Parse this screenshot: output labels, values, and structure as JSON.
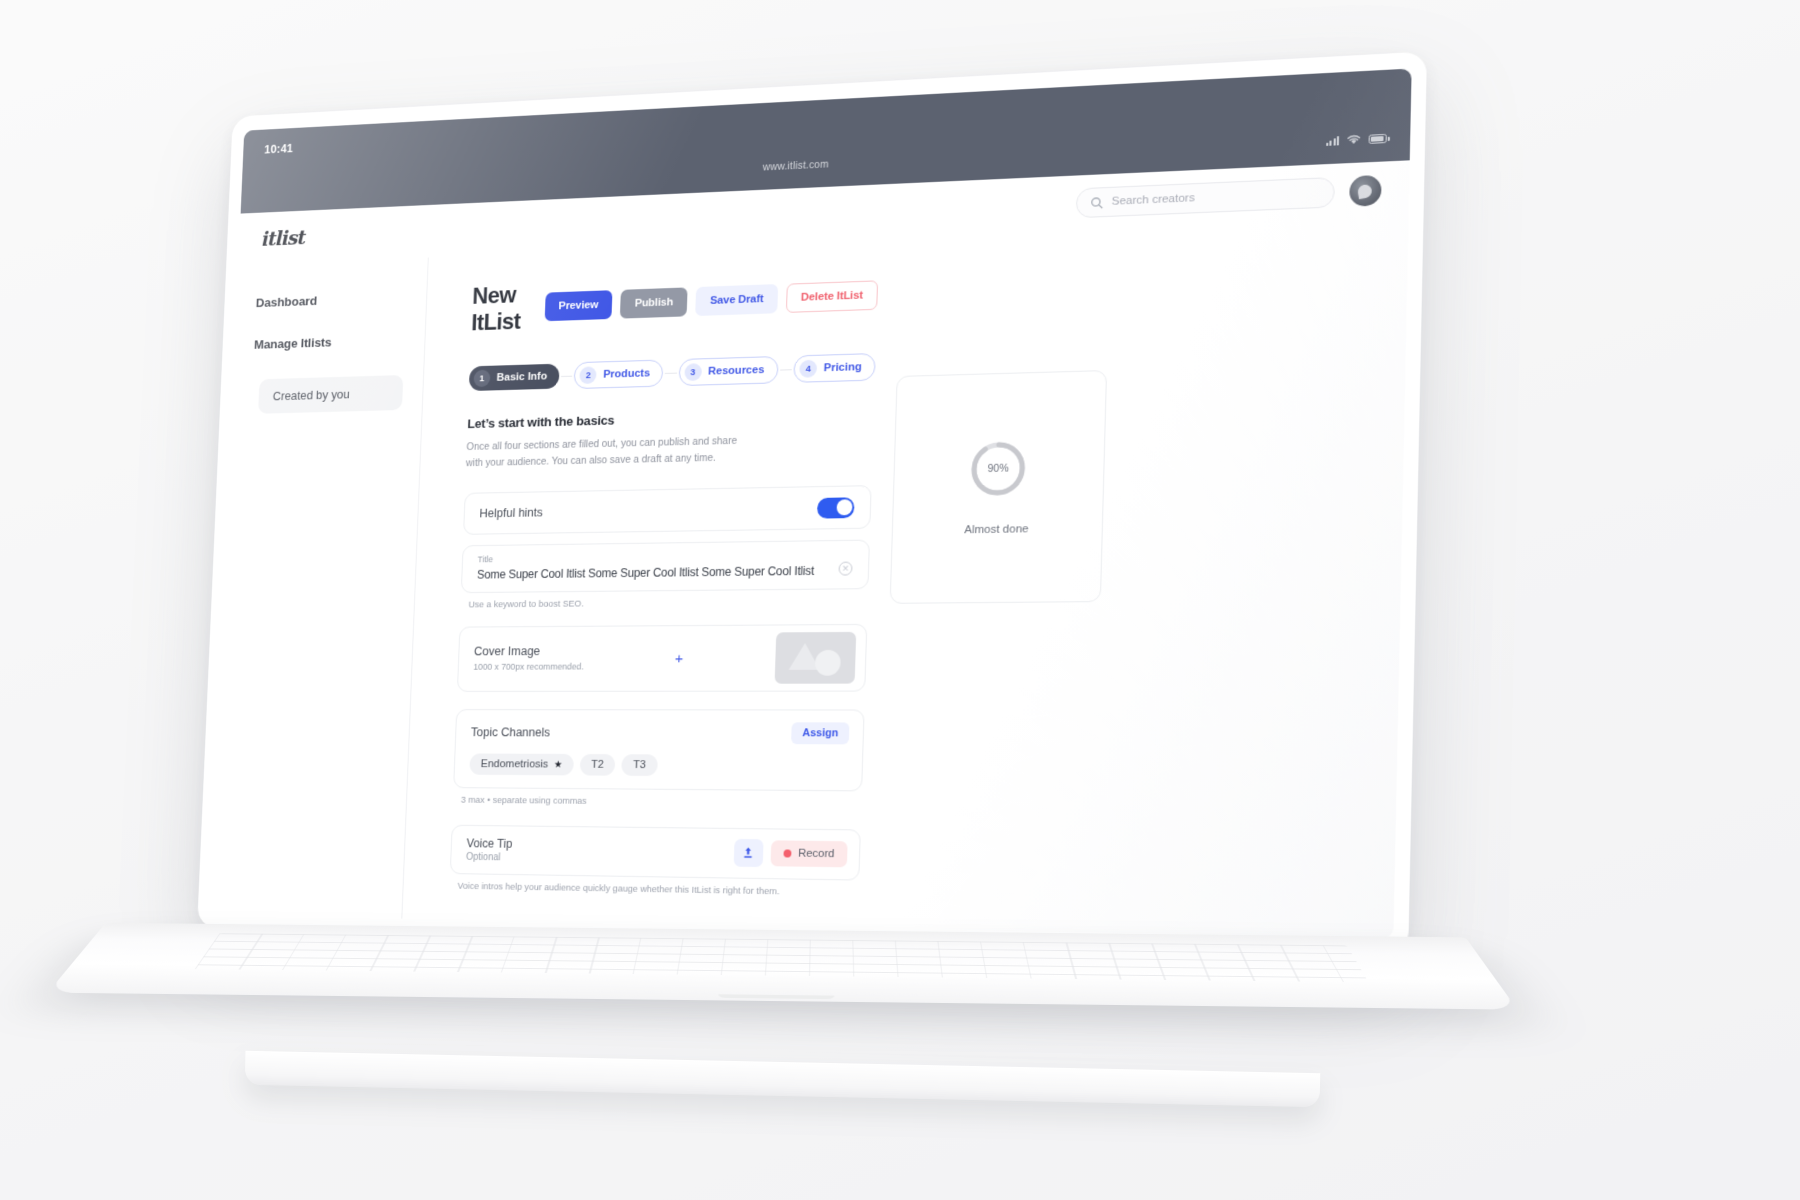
{
  "device": {
    "status_bar": {
      "clock": "10:41",
      "signal_icon": "signal-bars-icon",
      "wifi_icon": "wifi-icon",
      "battery_icon": "battery-icon"
    },
    "browser": {
      "url": "www.itlist.com"
    }
  },
  "appbar": {
    "logo": "itlist",
    "search": {
      "placeholder": "Search creators",
      "icon": "search-icon",
      "value": ""
    },
    "avatar": "user-avatar"
  },
  "sidebar": {
    "items": [
      {
        "label": "Dashboard"
      },
      {
        "label": "Manage Itlists"
      }
    ],
    "sub_items": [
      {
        "label": "Created by you",
        "selected": true
      }
    ]
  },
  "header": {
    "title": "New ItList",
    "buttons": [
      {
        "label": "Preview",
        "style": "primary",
        "color": "#4158e6"
      },
      {
        "label": "Publish",
        "style": "muted",
        "color": "#9499a6"
      },
      {
        "label": "Save Draft",
        "style": "soft",
        "color": "#4158e6"
      },
      {
        "label": "Delete ItList",
        "style": "danger-outline",
        "color": "#f0616e"
      }
    ]
  },
  "stepper": {
    "steps": [
      {
        "num": "1",
        "label": "Basic Info",
        "state": "active"
      },
      {
        "num": "2",
        "label": "Products",
        "state": "idle"
      },
      {
        "num": "3",
        "label": "Resources",
        "state": "idle"
      },
      {
        "num": "4",
        "label": "Pricing",
        "state": "idle"
      }
    ]
  },
  "section": {
    "title": "Let’s start with the basics",
    "description": "Once all four sections are filled out, you can publish and share with your audience.  You can also  save a draft at any time."
  },
  "hints": {
    "label": "Helpful hints",
    "toggle_on": true
  },
  "title_field": {
    "label": "Title",
    "value": "Some Super Cool Itlist Some Super Cool Itlist Some Super Cool Itlist",
    "clear_icon": "clear-circle-icon",
    "helper": "Use a keyword to boost SEO."
  },
  "cover_image": {
    "title": "Cover Image",
    "subtitle": "1000 x 700px recommended.",
    "add_icon": "plus-icon",
    "thumbnail": "image-placeholder"
  },
  "topics": {
    "title": "Topic Channels",
    "assign_label": "Assign",
    "tags": [
      {
        "label": "Endometriosis",
        "starred": true,
        "star_icon": "star-icon"
      },
      {
        "label": "T2",
        "starred": false
      },
      {
        "label": "T3",
        "starred": false
      }
    ],
    "helper": "3 max • separate using commas"
  },
  "voice": {
    "title": "Voice Tip",
    "subtitle": "Optional",
    "upload_icon": "upload-icon",
    "record_label": "Record",
    "record_icon": "record-dot-icon",
    "helper": "Voice intros help your audience quickly gauge whether this ItList is right for them."
  },
  "progress": {
    "percent": "90%",
    "percent_value": 90,
    "status": "Almost done",
    "track_color": "#dfe0e4",
    "fill_color": "#c8c9ce"
  }
}
